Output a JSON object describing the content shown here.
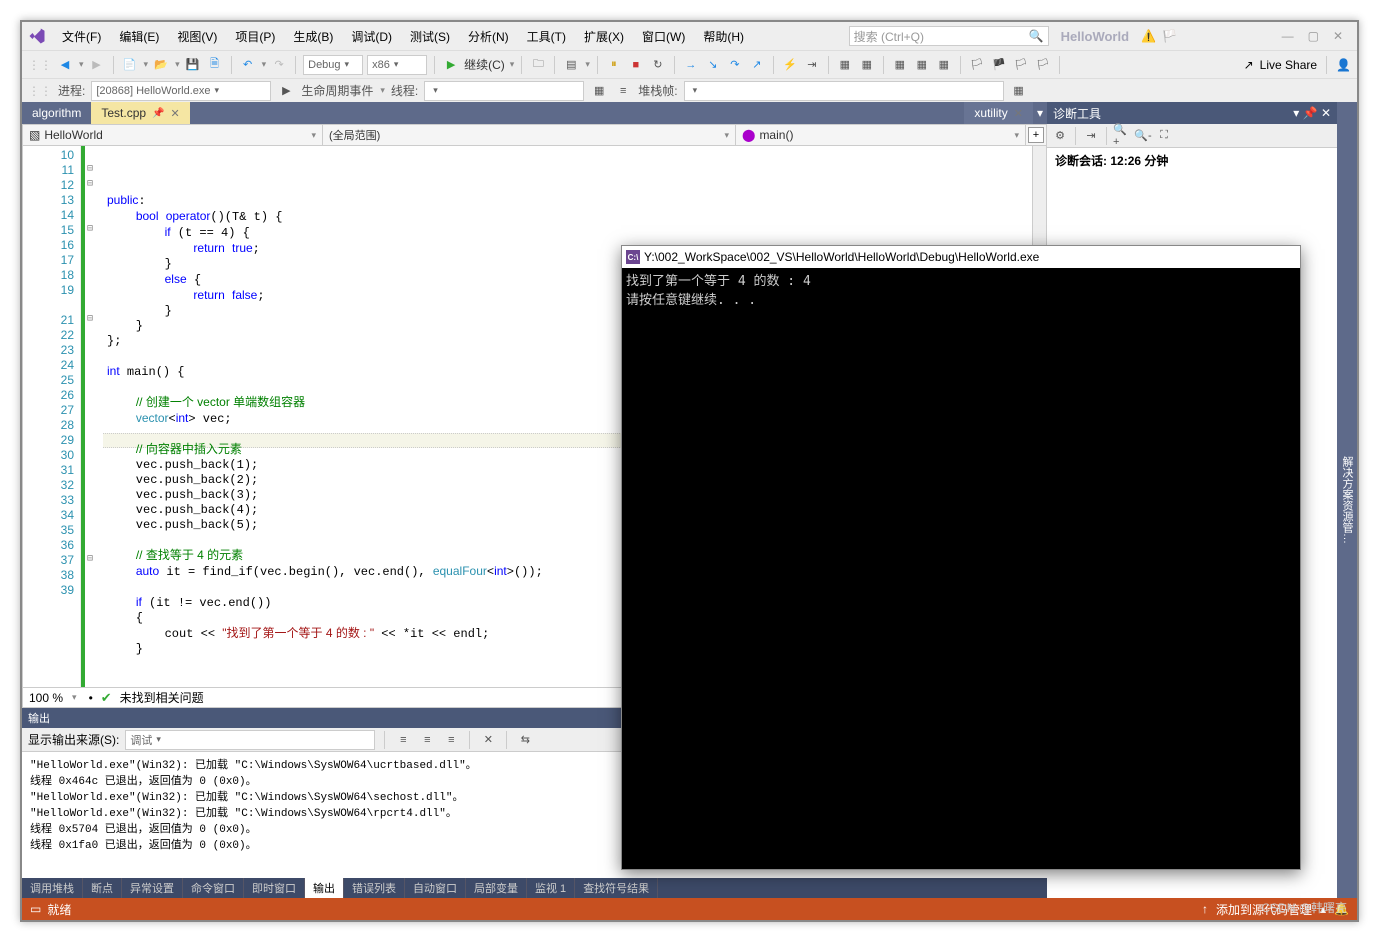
{
  "menus": [
    "文件(F)",
    "编辑(E)",
    "视图(V)",
    "项目(P)",
    "生成(B)",
    "调试(D)",
    "测试(S)",
    "分析(N)",
    "工具(T)",
    "扩展(X)",
    "窗口(W)",
    "帮助(H)"
  ],
  "search_placeholder": "搜索 (Ctrl+Q)",
  "app_name": "HelloWorld",
  "toolbar": {
    "config": "Debug",
    "platform": "x86",
    "continue": "继续(C)",
    "liveshare": "Live Share"
  },
  "debugbar": {
    "process_label": "进程:",
    "process": "[20868] HelloWorld.exe",
    "lifecycle": "生命周期事件",
    "thread": "线程:",
    "stack": "堆栈帧:"
  },
  "tabs": {
    "left": [
      "algorithm",
      "Test.cpp"
    ],
    "right": "xutility"
  },
  "nav": {
    "scope": "HelloWorld",
    "mid": "(全局范围)",
    "func": "main()"
  },
  "lines": [
    10,
    11,
    12,
    13,
    14,
    15,
    16,
    17,
    18,
    19,
    "",
    21,
    22,
    23,
    24,
    25,
    26,
    27,
    28,
    29,
    30,
    31,
    32,
    33,
    34,
    35,
    36,
    37,
    38,
    39
  ],
  "zoom": "100 %",
  "issues": "未找到相关问题",
  "diag": {
    "title": "诊断工具",
    "session_label": "诊断会话:",
    "session_time": "12:26 分钟"
  },
  "vtab": "解决方案资源管…",
  "output": {
    "title": "输出",
    "src_label": "显示输出来源(S):",
    "src_value": "调试",
    "text": "\"HelloWorld.exe\"(Win32): 已加载 \"C:\\Windows\\SysWOW64\\ucrtbased.dll\"。\n线程 0x464c 已退出，返回值为 0 (0x0)。\n\"HelloWorld.exe\"(Win32): 已加载 \"C:\\Windows\\SysWOW64\\sechost.dll\"。\n\"HelloWorld.exe\"(Win32): 已加载 \"C:\\Windows\\SysWOW64\\rpcrt4.dll\"。\n线程 0x5704 已退出，返回值为 0 (0x0)。\n线程 0x1fa0 已退出，返回值为 0 (0x0)。"
  },
  "bottom_tabs": [
    "调用堆栈",
    "断点",
    "异常设置",
    "命令窗口",
    "即时窗口",
    "输出",
    "错误列表",
    "自动窗口",
    "局部变量",
    "监视 1",
    "查找符号结果"
  ],
  "status": {
    "ready": "就绪",
    "source_ctrl": "添加到源代码管理"
  },
  "console": {
    "title": "Y:\\002_WorkSpace\\002_VS\\HelloWorld\\HelloWorld\\Debug\\HelloWorld.exe",
    "body": "找到了第一个等于 4 的数 : 4\n请按任意键继续. . ."
  },
  "code_html": "<span class='kw'>public</span>:\n    <span class='kw'>bool</span> <span class='kw'>operator</span>()(T&amp; t) {\n        <span class='kw'>if</span> (t == 4) {\n            <span class='kw'>return</span> <span class='kw'>true</span>;\n        }\n        <span class='kw'>else</span> {\n            <span class='kw'>return</span> <span class='kw'>false</span>;\n        }\n    }\n};\n\n<span class='kw'>int</span> main() {\n\n    <span class='cm'>// 创建一个 vector 单端数组容器</span>\n    <span class='cls'>vector</span>&lt;<span class='kw'>int</span>&gt; vec;\n\n    <span class='cm'>// 向容器中插入元素</span>\n    vec.push_back(1);\n    vec.push_back(2);\n    vec.push_back(3);\n    vec.push_back(4);\n    vec.push_back(5);\n\n    <span class='cm'>// 查找等于 4 的元素</span>\n    <span class='kw'>auto</span> it = find_if(vec.begin(), vec.end(), <span class='cls'>equalFour</span>&lt;<span class='kw'>int</span>&gt;());\n\n    <span class='kw'>if</span> (it != vec.end())\n    {\n        cout &lt;&lt; <span class='str'>\"找到了第一个等于 4 的数 : \"</span> &lt;&lt; *it &lt;&lt; endl;\n    }",
  "watermark": "CSDN @韩曙亮"
}
